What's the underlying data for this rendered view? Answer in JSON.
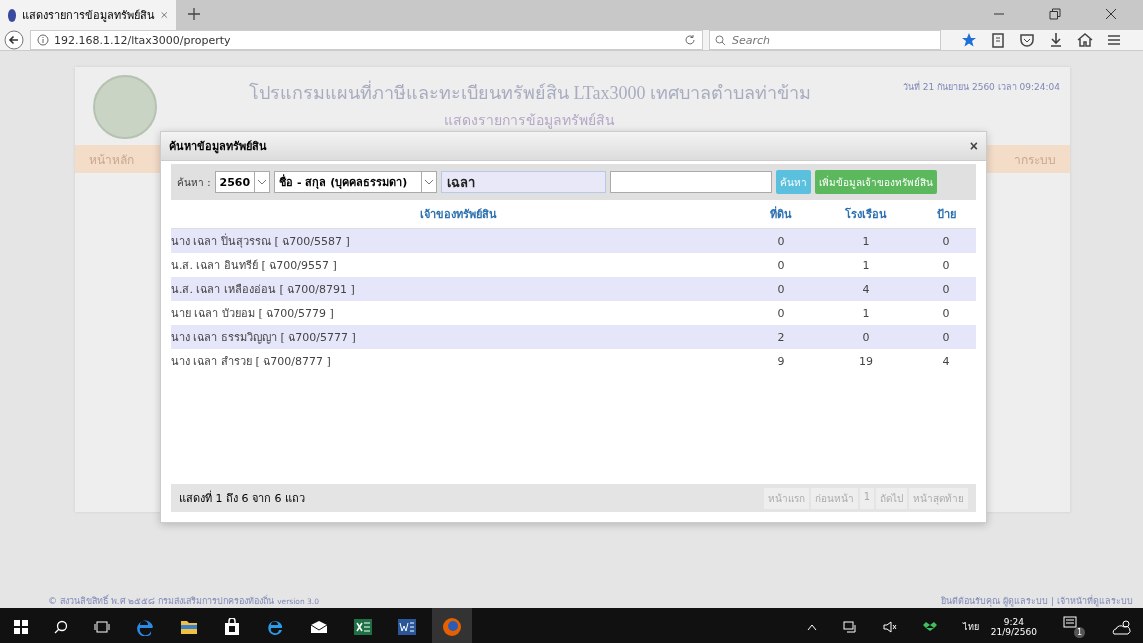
{
  "browser": {
    "tab_title": "แสดงรายการข้อมูลทรัพย์สิน",
    "url": "192.168.1.12/ltax3000/property",
    "search_placeholder": "Search"
  },
  "page": {
    "title": "โปรแกรมแผนที่ภาษีและทะเบียนทรัพย์สิน LTax3000 เทศบาลตำบลท่าข้าม",
    "subtitle": "แสดงรายการข้อมูลทรัพย์สิน",
    "datetime": "วันที่ 21 กันยายน 2560 เวลา 09:24:04",
    "menu": [
      "หน้าหลัก",
      "ากระบบ"
    ],
    "footer_left": "© สงวนลิขสิทธิ์ พ.ศ ๒๕๕๘ กรมส่งเสริมการปกครองท้องถิ่น",
    "footer_version": "version 3.0",
    "footer_right": "ยินดีต้อนรับคุณ ผู้ดูแลระบบ | เจ้าหน้าที่ดูแลระบบ"
  },
  "dialog": {
    "title": "ค้นหาข้อมูลทรัพย์สิน",
    "close": "×",
    "search_label": "ค้นหา :",
    "year": "2560",
    "search_type": "ชื่อ - สกุล (บุคคลธรรมดา)",
    "keyword": "เฉลา",
    "search_button": "ค้นหา",
    "add_button": "เพิ่มข้อมูลเจ้าของทรัพย์สิน",
    "table": {
      "columns": [
        "เจ้าของทรัพย์สิน",
        "ที่ดิน",
        "โรงเรือน",
        "ป้าย"
      ],
      "rows": [
        {
          "owner": "นาง เฉลา ปิ่นสุวรรณ [ ฉ700/5587 ]",
          "land": "0",
          "building": "1",
          "sign": "0"
        },
        {
          "owner": "น.ส. เฉลา อินทรีย์ [ ฉ700/9557 ]",
          "land": "0",
          "building": "1",
          "sign": "0"
        },
        {
          "owner": "น.ส. เฉลา เหลืองอ่อน [ ฉ700/8791 ]",
          "land": "0",
          "building": "4",
          "sign": "0"
        },
        {
          "owner": "นาย เฉลา บัวยอม [ ฉ700/5779 ]",
          "land": "0",
          "building": "1",
          "sign": "0"
        },
        {
          "owner": "นาง เฉลา ธรรมวิญญา [ ฉ700/5777 ]",
          "land": "2",
          "building": "0",
          "sign": "0"
        },
        {
          "owner": "นาง เฉลา สำรวย [ ฉ700/8777 ]",
          "land": "9",
          "building": "19",
          "sign": "4"
        }
      ]
    },
    "summary": "แสดงที่ 1 ถึง 6 จาก 6 แถว",
    "pagination": [
      "หน้าแรก",
      "ก่อนหน้า",
      "1",
      "ถัดไป",
      "หน้าสุดท้าย"
    ]
  },
  "taskbar": {
    "language": "ไทย",
    "time": "9:24",
    "date": "21/9/2560",
    "notifications": "1"
  }
}
